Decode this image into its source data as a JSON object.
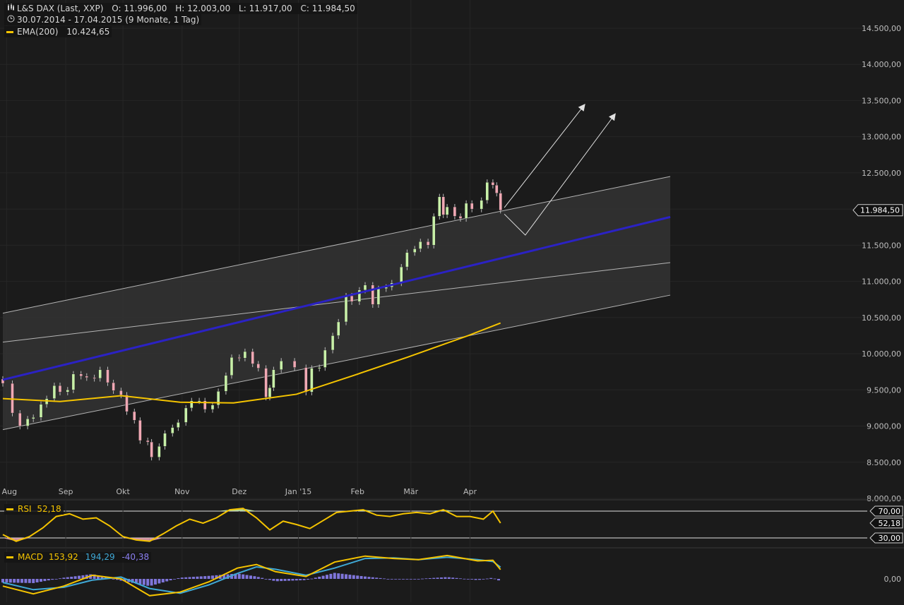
{
  "header": {
    "title_icon": "candlestick-icon",
    "title": "L&S DAX (Last, XXP)",
    "ohlc": {
      "open": "O: 11.996,00",
      "high": "H: 12.003,00",
      "low": "L: 11.917,00",
      "close": "C: 11.984,50"
    },
    "period_icon": "clock-icon",
    "period": "30.07.2014 - 17.04.2015 (9 Monate, 1 Tag)",
    "ema_label": "EMA(200)",
    "ema_value": "10.424,65"
  },
  "colors": {
    "background": "#1b1b1b",
    "up_candle": "#c8f0a8",
    "down_candle": "#f0a8b4",
    "ema": "#f5c400",
    "trend_line": "#2b22c4",
    "channel_fill": "#333333",
    "channel_line": "#d8d8d8",
    "rsi": "#f5c400",
    "macd": "#f5c400",
    "signal": "#3fa9d6",
    "histogram": "#8b7ff0",
    "rsi_overbought_fill": "#c8f0a8",
    "rsi_oversold_fill": "#f0a8b4"
  },
  "price_badge": "11.984,50",
  "rsi_panel": {
    "label": "RSI",
    "value": "52,18",
    "level_70": "70,00",
    "level_value": "52,18",
    "level_30": "30,00"
  },
  "macd_panel": {
    "label": "MACD",
    "macd_value": "153,92",
    "signal_value": "194,29",
    "hist_value": "-40,38",
    "zero_label": "0,00"
  },
  "chart_data": [
    {
      "type": "candlestick",
      "title": "L&S DAX (Last, XXP)",
      "y_unit": "points",
      "ylim": [
        8000,
        14700
      ],
      "y_ticks": [
        8000,
        8500,
        9000,
        9500,
        10000,
        10500,
        11000,
        11500,
        12000,
        12500,
        13000,
        13500,
        14000,
        14500
      ],
      "y_tick_labels": [
        "8.000,00",
        "8.500,00",
        "9.000,00",
        "9.500,00",
        "10.000,00",
        "10.500,00",
        "11.000,00",
        "11.500,00",
        "12.000,00",
        "12.500,00",
        "13.000,00",
        "13.500,00",
        "14.000,00",
        "14.500,00"
      ],
      "x_range": [
        "2014-07-30",
        "2015-04-17"
      ],
      "x_ticks": [
        {
          "date": "2014-08-01",
          "label": "Aug"
        },
        {
          "date": "2014-09-01",
          "label": "Sep"
        },
        {
          "date": "2014-10-01",
          "label": "Okt"
        },
        {
          "date": "2014-11-01",
          "label": "Nov"
        },
        {
          "date": "2014-12-01",
          "label": "Dez"
        },
        {
          "date": "2015-01-01",
          "label": "Jan '15"
        },
        {
          "date": "2015-02-01",
          "label": "Feb"
        },
        {
          "date": "2015-03-01",
          "label": "Mär"
        },
        {
          "date": "2015-04-01",
          "label": "Apr"
        }
      ],
      "close": [
        [
          "2014-07-30",
          9590
        ],
        [
          "2014-08-04",
          9180
        ],
        [
          "2014-08-08",
          9000
        ],
        [
          "2014-08-12",
          9100
        ],
        [
          "2014-08-15",
          9120
        ],
        [
          "2014-08-19",
          9300
        ],
        [
          "2014-08-22",
          9380
        ],
        [
          "2014-08-26",
          9560
        ],
        [
          "2014-08-29",
          9470
        ],
        [
          "2014-09-02",
          9500
        ],
        [
          "2014-09-05",
          9720
        ],
        [
          "2014-09-09",
          9690
        ],
        [
          "2014-09-12",
          9670
        ],
        [
          "2014-09-16",
          9660
        ],
        [
          "2014-09-19",
          9780
        ],
        [
          "2014-09-23",
          9600
        ],
        [
          "2014-09-26",
          9490
        ],
        [
          "2014-09-30",
          9430
        ],
        [
          "2014-10-03",
          9200
        ],
        [
          "2014-10-07",
          9080
        ],
        [
          "2014-10-10",
          8800
        ],
        [
          "2014-10-14",
          8780
        ],
        [
          "2014-10-16",
          8570
        ],
        [
          "2014-10-20",
          8720
        ],
        [
          "2014-10-23",
          8900
        ],
        [
          "2014-10-27",
          8980
        ],
        [
          "2014-10-30",
          9050
        ],
        [
          "2014-11-03",
          9250
        ],
        [
          "2014-11-06",
          9350
        ],
        [
          "2014-11-10",
          9350
        ],
        [
          "2014-11-13",
          9230
        ],
        [
          "2014-11-17",
          9290
        ],
        [
          "2014-11-20",
          9480
        ],
        [
          "2014-11-24",
          9700
        ],
        [
          "2014-11-27",
          9950
        ],
        [
          "2014-12-01",
          9940
        ],
        [
          "2014-12-04",
          10030
        ],
        [
          "2014-12-08",
          9860
        ],
        [
          "2014-12-11",
          9800
        ],
        [
          "2014-12-15",
          9400
        ],
        [
          "2014-12-17",
          9530
        ],
        [
          "2014-12-19",
          9780
        ],
        [
          "2014-12-23",
          9900
        ],
        [
          "2014-12-30",
          9810
        ],
        [
          "2015-01-05",
          9470
        ],
        [
          "2015-01-08",
          9800
        ],
        [
          "2015-01-12",
          9810
        ],
        [
          "2015-01-15",
          10050
        ],
        [
          "2015-01-19",
          10250
        ],
        [
          "2015-01-22",
          10440
        ],
        [
          "2015-01-26",
          10800
        ],
        [
          "2015-01-29",
          10720
        ],
        [
          "2015-02-02",
          10880
        ],
        [
          "2015-02-05",
          10950
        ],
        [
          "2015-02-09",
          10680
        ],
        [
          "2015-02-12",
          10900
        ],
        [
          "2015-02-16",
          10920
        ],
        [
          "2015-02-19",
          10980
        ],
        [
          "2015-02-24",
          11200
        ],
        [
          "2015-02-27",
          11400
        ],
        [
          "2015-03-03",
          11450
        ],
        [
          "2015-03-06",
          11550
        ],
        [
          "2015-03-10",
          11500
        ],
        [
          "2015-03-13",
          11900
        ],
        [
          "2015-03-16",
          12170
        ],
        [
          "2015-03-18",
          11920
        ],
        [
          "2015-03-20",
          12030
        ],
        [
          "2015-03-24",
          11900
        ],
        [
          "2015-03-27",
          11870
        ],
        [
          "2015-03-30",
          12080
        ],
        [
          "2015-04-02",
          12000
        ],
        [
          "2015-04-07",
          12120
        ],
        [
          "2015-04-10",
          12370
        ],
        [
          "2015-04-13",
          12330
        ],
        [
          "2015-04-15",
          12220
        ],
        [
          "2015-04-17",
          11984.5
        ]
      ],
      "ema_200": [
        [
          "2014-07-30",
          9380
        ],
        [
          "2014-08-29",
          9340
        ],
        [
          "2014-09-30",
          9420
        ],
        [
          "2014-10-31",
          9330
        ],
        [
          "2014-11-28",
          9320
        ],
        [
          "2014-12-31",
          9440
        ],
        [
          "2015-01-30",
          9700
        ],
        [
          "2015-02-27",
          9950
        ],
        [
          "2015-03-31",
          10250
        ],
        [
          "2015-04-17",
          10424.65
        ]
      ],
      "trend_line": [
        [
          "2014-07-30",
          9640
        ],
        [
          "2015-07-15",
          11890
        ]
      ],
      "channel_upper": [
        [
          "2014-07-30",
          10560
        ],
        [
          "2015-07-15",
          12450
        ]
      ],
      "channel_mid": [
        [
          "2014-07-30",
          10160
        ],
        [
          "2015-07-15",
          11260
        ]
      ],
      "channel_lower": [
        [
          "2014-07-30",
          8950
        ],
        [
          "2015-07-15",
          10810
        ]
      ],
      "projection_arrows": [
        [
          [
            "2015-04-19",
            12020
          ],
          [
            "2015-05-31",
            13440
          ]
        ],
        [
          [
            "2015-04-19",
            11930
          ],
          [
            "2015-04-30",
            11640
          ],
          [
            "2015-06-16",
            13310
          ]
        ]
      ],
      "last_price": 11984.5
    },
    {
      "type": "line",
      "title": "RSI",
      "ylim": [
        20,
        80
      ],
      "levels": [
        30,
        70
      ],
      "series": [
        {
          "name": "RSI",
          "points": [
            [
              "2014-07-30",
              35
            ],
            [
              "2014-08-06",
              25
            ],
            [
              "2014-08-13",
              32
            ],
            [
              "2014-08-20",
              45
            ],
            [
              "2014-08-27",
              62
            ],
            [
              "2014-09-03",
              66
            ],
            [
              "2014-09-10",
              58
            ],
            [
              "2014-09-17",
              60
            ],
            [
              "2014-09-24",
              48
            ],
            [
              "2014-10-01",
              32
            ],
            [
              "2014-10-08",
              27
            ],
            [
              "2014-10-15",
              25
            ],
            [
              "2014-10-22",
              36
            ],
            [
              "2014-10-29",
              48
            ],
            [
              "2014-11-05",
              58
            ],
            [
              "2014-11-12",
              52
            ],
            [
              "2014-11-19",
              60
            ],
            [
              "2014-11-26",
              72
            ],
            [
              "2014-12-03",
              74
            ],
            [
              "2014-12-10",
              60
            ],
            [
              "2014-12-17",
              42
            ],
            [
              "2014-12-24",
              55
            ],
            [
              "2014-12-31",
              50
            ],
            [
              "2015-01-07",
              44
            ],
            [
              "2015-01-14",
              56
            ],
            [
              "2015-01-21",
              68
            ],
            [
              "2015-01-28",
              70
            ],
            [
              "2015-02-04",
              72
            ],
            [
              "2015-02-11",
              64
            ],
            [
              "2015-02-18",
              62
            ],
            [
              "2015-02-25",
              66
            ],
            [
              "2015-03-04",
              68
            ],
            [
              "2015-03-11",
              66
            ],
            [
              "2015-03-18",
              72
            ],
            [
              "2015-03-25",
              62
            ],
            [
              "2015-04-01",
              62
            ],
            [
              "2015-04-08",
              58
            ],
            [
              "2015-04-13",
              70
            ],
            [
              "2015-04-17",
              52.18
            ]
          ]
        }
      ]
    },
    {
      "type": "line",
      "title": "MACD",
      "ylim": [
        -500,
        500
      ],
      "zero_label": "0,00",
      "series": [
        {
          "name": "MACD",
          "points": [
            [
              "2014-07-30",
              -120
            ],
            [
              "2014-08-15",
              -250
            ],
            [
              "2014-08-31",
              -120
            ],
            [
              "2014-09-15",
              60
            ],
            [
              "2014-09-30",
              0
            ],
            [
              "2014-10-15",
              -280
            ],
            [
              "2014-10-31",
              -220
            ],
            [
              "2014-11-15",
              -50
            ],
            [
              "2014-11-30",
              180
            ],
            [
              "2014-12-10",
              240
            ],
            [
              "2014-12-20",
              120
            ],
            [
              "2015-01-05",
              40
            ],
            [
              "2015-01-20",
              280
            ],
            [
              "2015-02-05",
              380
            ],
            [
              "2015-02-20",
              340
            ],
            [
              "2015-03-05",
              320
            ],
            [
              "2015-03-20",
              390
            ],
            [
              "2015-04-05",
              300
            ],
            [
              "2015-04-13",
              310
            ],
            [
              "2015-04-17",
              153.92
            ]
          ]
        },
        {
          "name": "Signal",
          "points": [
            [
              "2014-07-30",
              -60
            ],
            [
              "2014-08-15",
              -180
            ],
            [
              "2014-08-31",
              -140
            ],
            [
              "2014-09-15",
              -20
            ],
            [
              "2014-09-30",
              30
            ],
            [
              "2014-10-15",
              -160
            ],
            [
              "2014-10-31",
              -240
            ],
            [
              "2014-11-15",
              -100
            ],
            [
              "2014-11-30",
              90
            ],
            [
              "2014-12-10",
              200
            ],
            [
              "2014-12-20",
              160
            ],
            [
              "2015-01-05",
              60
            ],
            [
              "2015-01-20",
              180
            ],
            [
              "2015-02-05",
              340
            ],
            [
              "2015-02-20",
              350
            ],
            [
              "2015-03-05",
              320
            ],
            [
              "2015-03-20",
              360
            ],
            [
              "2015-04-05",
              320
            ],
            [
              "2015-04-13",
              290
            ],
            [
              "2015-04-17",
              194.29
            ]
          ]
        },
        {
          "name": "Histogram",
          "bars": [
            [
              "2014-07-30",
              -60
            ],
            [
              "2014-08-15",
              -70
            ],
            [
              "2014-08-31",
              20
            ],
            [
              "2014-09-15",
              80
            ],
            [
              "2014-09-30",
              -30
            ],
            [
              "2014-10-15",
              -120
            ],
            [
              "2014-10-31",
              20
            ],
            [
              "2014-11-15",
              50
            ],
            [
              "2014-11-30",
              90
            ],
            [
              "2014-12-10",
              40
            ],
            [
              "2014-12-20",
              -40
            ],
            [
              "2015-01-05",
              -20
            ],
            [
              "2015-01-20",
              100
            ],
            [
              "2015-02-05",
              40
            ],
            [
              "2015-02-20",
              -10
            ],
            [
              "2015-03-05",
              0
            ],
            [
              "2015-03-20",
              30
            ],
            [
              "2015-04-05",
              -20
            ],
            [
              "2015-04-13",
              20
            ],
            [
              "2015-04-17",
              -40.38
            ]
          ]
        }
      ]
    }
  ]
}
